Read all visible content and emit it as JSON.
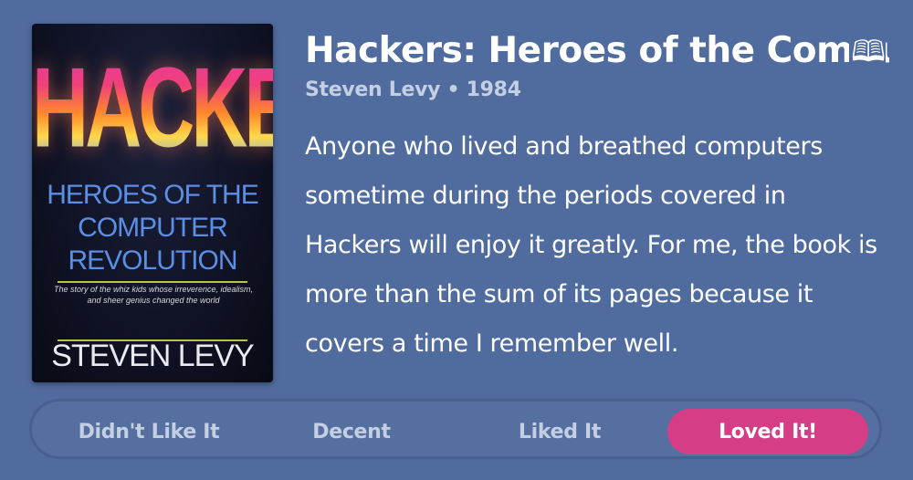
{
  "book": {
    "title": "Hackers: Heroes of the Compu",
    "title_icon": "open-book-icon",
    "meta": "Steven Levy • 1984",
    "review": "Anyone who lived and breathed computers sometime during the periods covered in Hackers will enjoy it greatly. For me, the book is more than the sum of its pages because it covers a time I remember well."
  },
  "cover": {
    "title": "HACKERS",
    "subtitle_line1": "HEROES OF THE",
    "subtitle_line2": "COMPUTER",
    "subtitle_line3": "REVOLUTION",
    "blurb": "The story of the whiz kids whose irreverence, idealism, and sheer genius changed the world",
    "author": "STEVEN LEVY"
  },
  "rating": {
    "options": [
      "Didn't Like It",
      "Decent",
      "Liked It",
      "Loved It!"
    ],
    "selected": "Loved It!",
    "selected_index": 3
  },
  "colors": {
    "background": "#506b9d",
    "accent": "#d53d86",
    "muted_text": "#c5cfe3"
  }
}
